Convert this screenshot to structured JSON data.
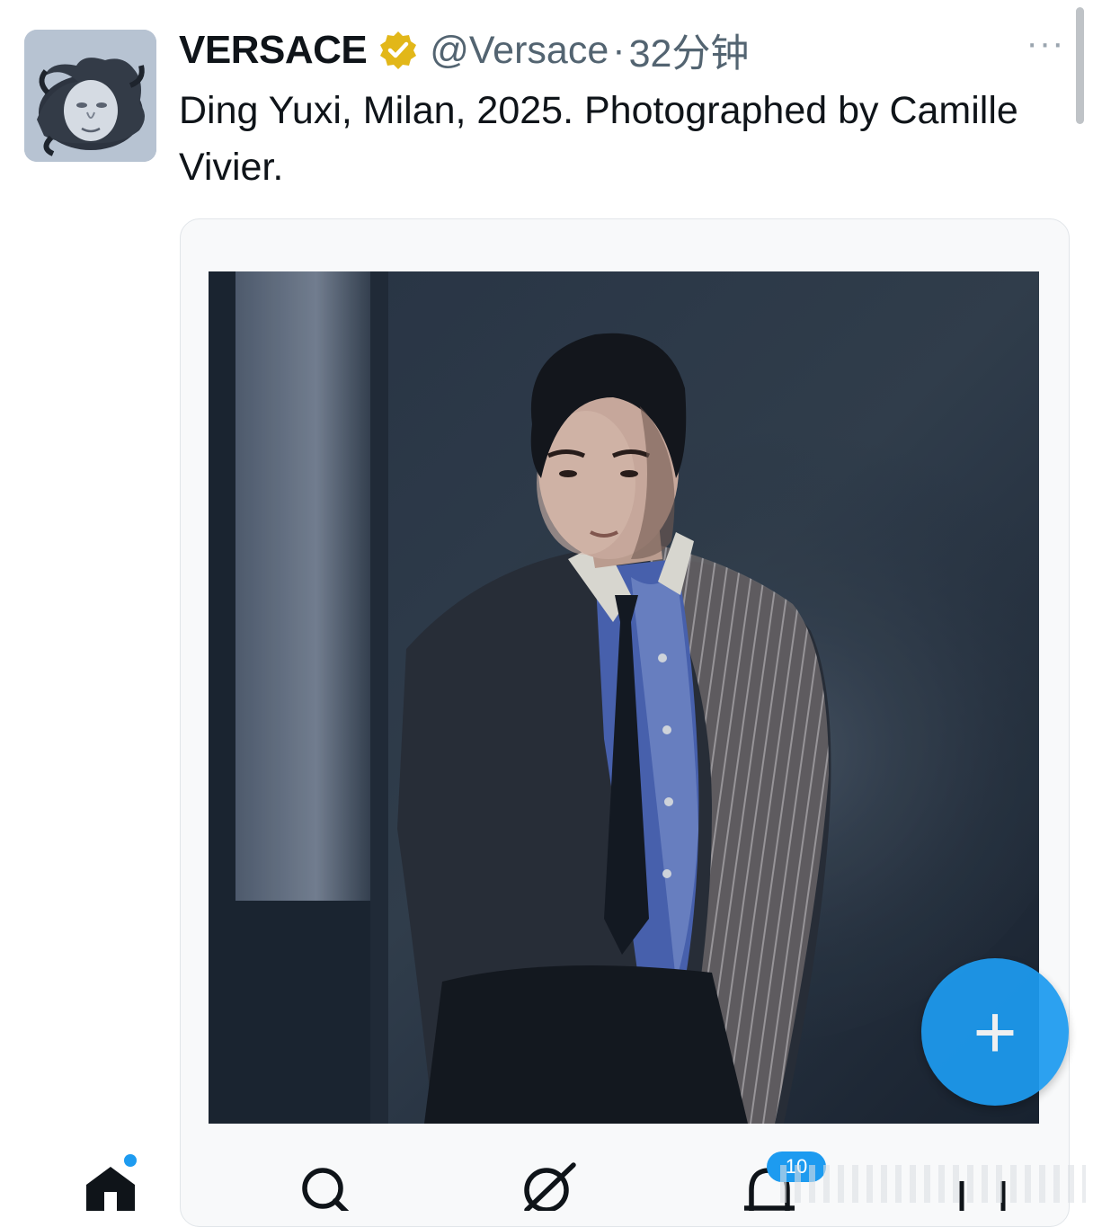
{
  "tweet": {
    "display_name": "VERSACE",
    "handle": "@Versace",
    "separator": "·",
    "time": "32分钟",
    "more_label": "···",
    "text": "Ding Yuxi, Milan, 2025. Photographed by Camille Vivier."
  },
  "fab": {
    "label": "+"
  },
  "nav": {
    "items": [
      {
        "name": "home",
        "icon": "home-icon"
      },
      {
        "name": "search",
        "icon": "search-icon"
      },
      {
        "name": "grok",
        "icon": "grok-icon"
      },
      {
        "name": "notifications",
        "icon": "bell-icon"
      }
    ],
    "notification_badge": "10"
  },
  "colors": {
    "accent": "#1d9bf0",
    "verified_gold": "#e2b719",
    "text": "#0f1419",
    "muted": "#536471"
  }
}
